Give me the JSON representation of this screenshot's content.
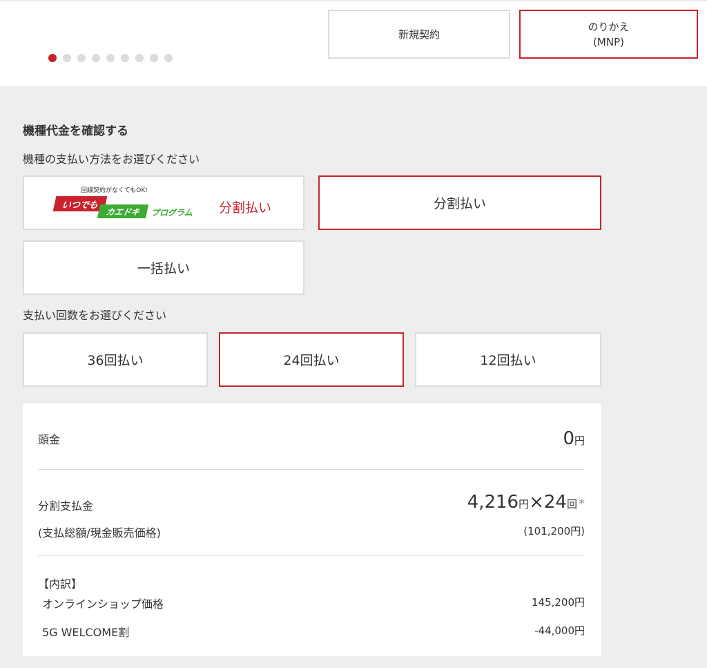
{
  "contract": {
    "new_label": "新規契約",
    "mnp_line1": "のりかえ",
    "mnp_line2": "(MNP)"
  },
  "carousel": {
    "count": 9,
    "active_index": 0
  },
  "accent_color": "#c8232c",
  "section": {
    "heading": "機種代金を確認する",
    "payment_method_label": "機種の支払い方法をお選びください",
    "payment_count_label": "支払い回数をお選びください"
  },
  "payment_methods": {
    "promo": {
      "small_text": "回線契約がなくてもOK!",
      "logo_red": "いつでも",
      "logo_green": "カエドキ",
      "logo_suffix": "プログラム",
      "label": "分割払い"
    },
    "installment_label": "分割払い",
    "lump_sum_label": "一括払い"
  },
  "payment_counts": [
    "36回払い",
    "24回払い",
    "12回払い"
  ],
  "summary": {
    "down_payment_label": "頭金",
    "down_payment_value": "0",
    "yen": "円",
    "installment_label": "分割支払金",
    "installment_amount": "4,216",
    "times": "×24",
    "kai": "回",
    "asterisk": "*",
    "total_label": "(支払総額/現金販売価格)",
    "total_value": "(101,200円)",
    "breakdown_label": "【内訳】",
    "online_price_label": "オンラインショップ価格",
    "online_price_value": "145,200円",
    "discount_label": "5G WELCOME割",
    "discount_value": "-44,000円"
  }
}
